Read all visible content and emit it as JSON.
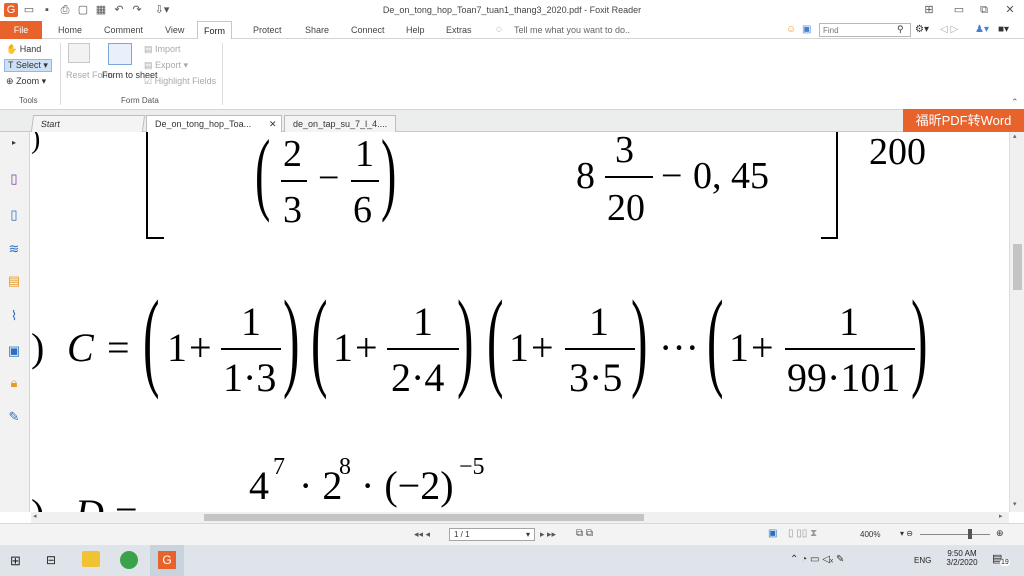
{
  "window": {
    "title": "De_on_tong_hop_Toan7_tuan1_thang3_2020.pdf - Foxit Reader"
  },
  "tabs": [
    "File",
    "Home",
    "Comment",
    "View",
    "Form",
    "Protect",
    "Share",
    "Connect",
    "Help",
    "Extras"
  ],
  "tell_me": "Tell me what you want to do..",
  "search": {
    "placeholder": "Find"
  },
  "ribbon": {
    "tools": {
      "hand": "Hand",
      "select": "Select",
      "zoom": "Zoom",
      "label": "Tools"
    },
    "form": {
      "reset": "Reset Form",
      "form_to_sheet": "Form to sheet",
      "import": "Import",
      "export": "Export",
      "highlight": "Highlight Fields",
      "label": "Form Data"
    }
  },
  "doc_tabs": [
    "Start",
    "De_on_tong_hop_Toa...",
    "de_on_tap_su_7_l_4...."
  ],
  "promo": "福昕PDF转Word",
  "math": {
    "n2": "2",
    "n3": "3",
    "n1": "1",
    "n6": "6",
    "n8": "8",
    "n3b": "3",
    "n20": "20",
    "n045": "0, 45",
    "n200": "200",
    "c_label": "C",
    "one": "1",
    "d1": "1·3",
    "d2": "2·4",
    "d3": "3·5",
    "d4": "99·101",
    "d_top": "4",
    "e7": "7",
    "d_mid": "· 2",
    "e8": "8",
    "d_rest": "· (−2)",
    "em5": "−5",
    "d_label": "D"
  },
  "status": {
    "page": "1 / 1",
    "zoom": "400%"
  },
  "taskbar": {
    "time": "9:50 AM",
    "date": "3/2/2020",
    "lang": "ENG",
    "badge": "19"
  }
}
